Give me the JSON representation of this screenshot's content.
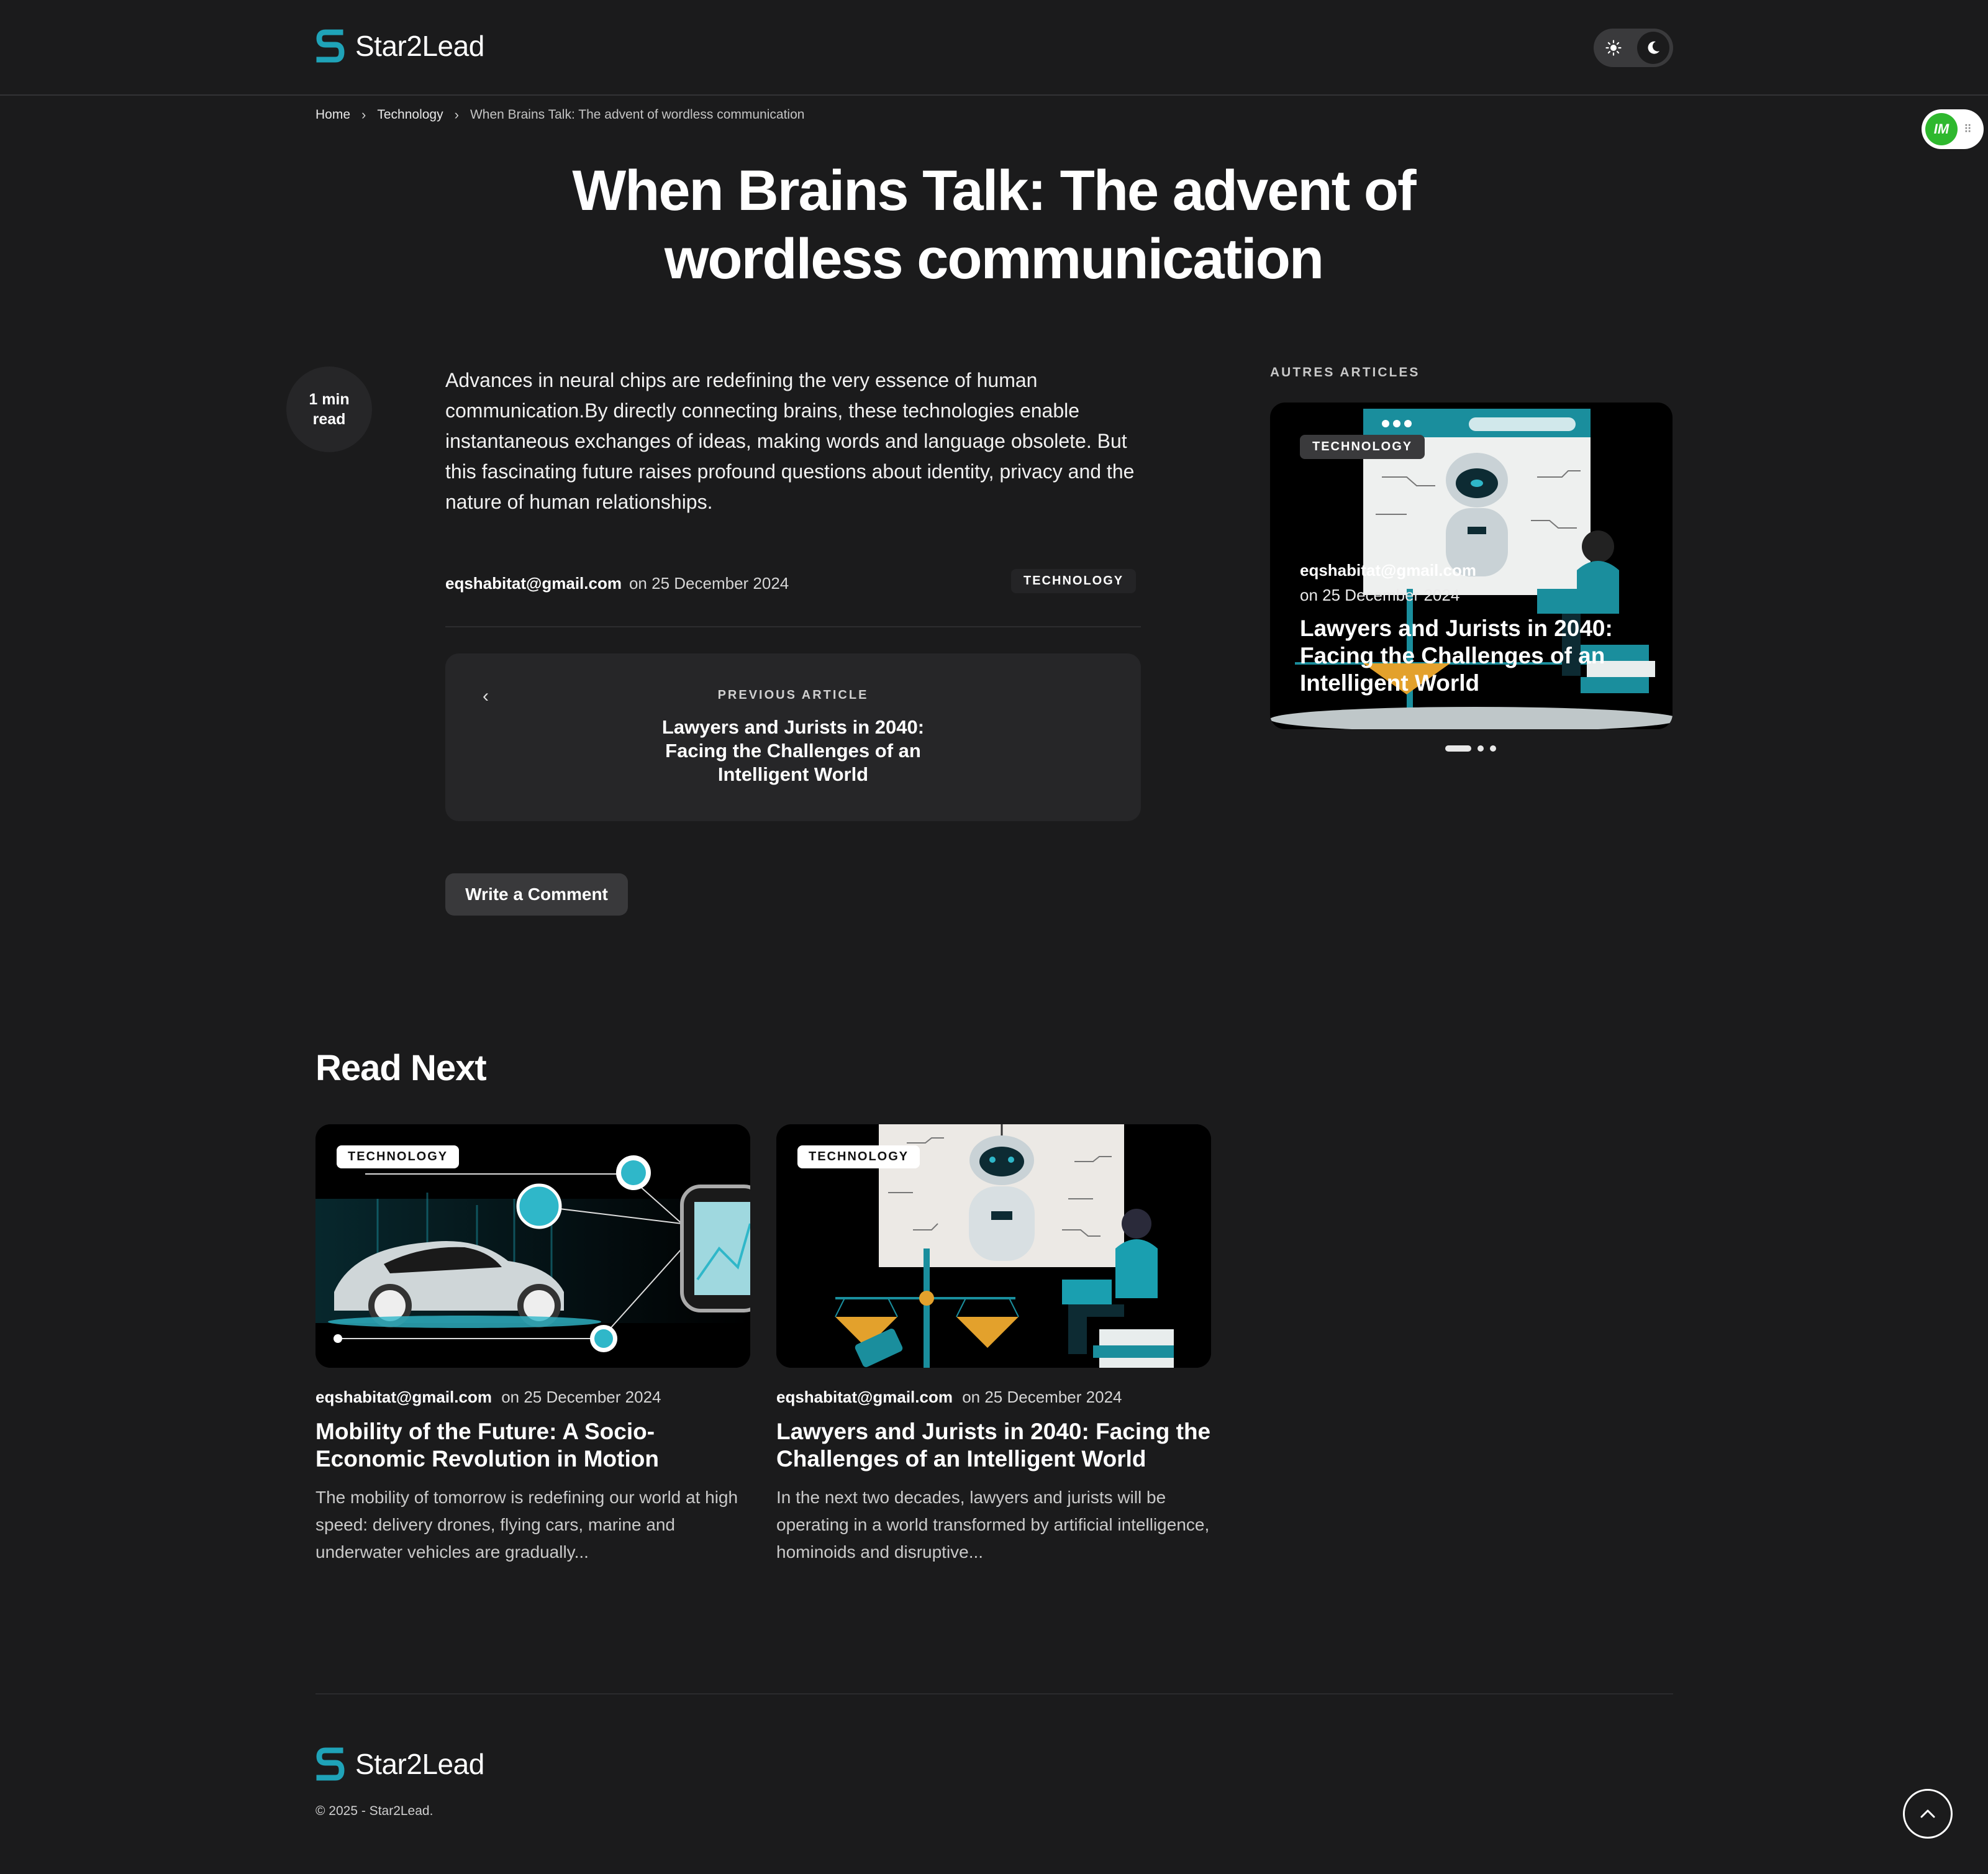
{
  "brand": {
    "name": "Star2Lead",
    "accent": "#1fa3b8"
  },
  "header": {
    "theme_light_icon": "sun-icon",
    "theme_dark_icon": "moon-icon"
  },
  "breadcrumb": {
    "home": "Home",
    "category": "Technology",
    "current": "When Brains Talk: The advent of wordless communication"
  },
  "badge": {
    "label": "IM"
  },
  "article": {
    "title": "When Brains Talk: The advent of wordless communication",
    "read_time_line1": "1 min",
    "read_time_line2": "read",
    "excerpt": "Advances in neural chips are redefining the very essence of human communication.By directly connecting brains, these technologies enable instantaneous exchanges of ideas, making words and language obsolete. But this fascinating future raises profound questions about identity, privacy and the nature of human relationships.",
    "author": "eqshabitat@gmail.com",
    "date": "on 25 December 2024",
    "category": "TECHNOLOGY"
  },
  "previous": {
    "label": "PREVIOUS ARTICLE",
    "title": "Lawyers and Jurists in 2040: Facing the Challenges of an Intelligent World"
  },
  "comment_button": "Write a Comment",
  "sidebar": {
    "label": "AUTRES ARTICLES",
    "card": {
      "tag": "TECHNOLOGY",
      "author": "eqshabitat@gmail.com",
      "date": "on 25 December 2024",
      "title": "Lawyers and Jurists in 2040: Facing the Challenges of an Intelligent World"
    },
    "slides": 3,
    "active_slide": 1
  },
  "read_next": {
    "heading": "Read Next",
    "cards": [
      {
        "tag": "TECHNOLOGY",
        "author": "eqshabitat@gmail.com",
        "date": "on 25 December 2024",
        "title": "Mobility of the Future: A Socio-Economic Revolution in Motion",
        "excerpt": "The mobility of tomorrow is redefining our world at high speed: delivery drones, flying cars, marine and underwater vehicles are gradually..."
      },
      {
        "tag": "TECHNOLOGY",
        "author": "eqshabitat@gmail.com",
        "date": "on 25 December 2024",
        "title": "Lawyers and Jurists in 2040: Facing the Challenges of an Intelligent World",
        "excerpt": "In the next two decades, lawyers and jurists will be operating in a world transformed by artificial intelligence, hominoids and disruptive..."
      }
    ]
  },
  "footer": {
    "copyright": "© 2025 - Star2Lead."
  }
}
